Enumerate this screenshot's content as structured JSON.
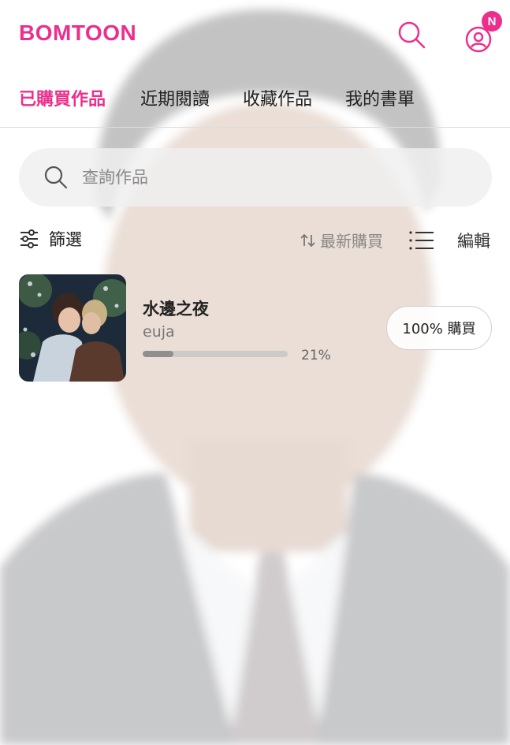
{
  "app": {
    "logo_text": "BOMTOON",
    "brand_color": "#ec2f8c"
  },
  "header": {
    "search_icon": "search-icon",
    "user_icon": "user-profile-icon",
    "notification_badge": "N"
  },
  "tabs": [
    {
      "label": "已購買作品",
      "active": true
    },
    {
      "label": "近期閱讀",
      "active": false
    },
    {
      "label": "收藏作品",
      "active": false
    },
    {
      "label": "我的書單",
      "active": false
    }
  ],
  "search": {
    "placeholder": "查詢作品",
    "value": ""
  },
  "toolbar": {
    "filter_label": "篩選",
    "sort_label": "最新購買",
    "edit_label": "編輯"
  },
  "items": [
    {
      "title": "水邊之夜",
      "author": "euja",
      "progress": 0.21,
      "progress_text": "21%",
      "purchase_button": "100% 購買"
    }
  ]
}
